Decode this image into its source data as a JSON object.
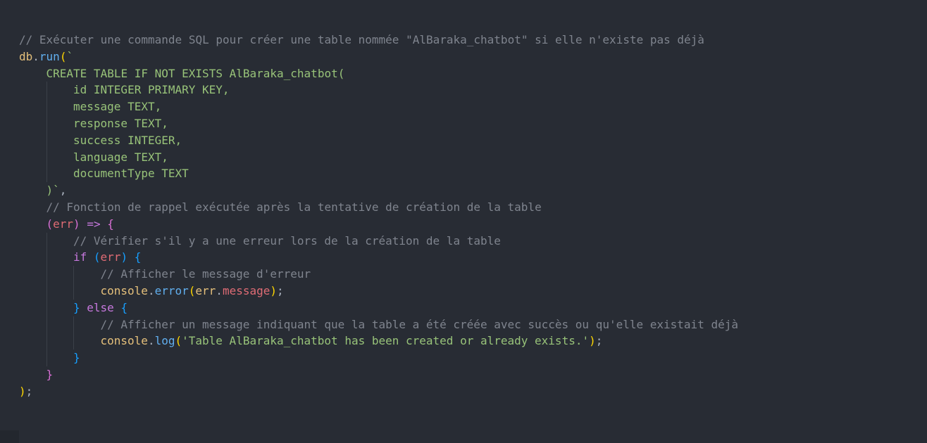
{
  "colors": {
    "background": "#282c34",
    "comment": "#7f848e",
    "string": "#98c379",
    "function": "#61afef",
    "object": "#e5c07b",
    "parameter": "#e06c75",
    "keyword": "#c678dd",
    "bracket_gold": "#ffd700",
    "bracket_magenta": "#da70d6",
    "bracket_blue": "#179fff"
  },
  "lines": [
    {
      "indent": 0,
      "tokens": [
        {
          "text": "// Exécuter une commande SQL pour créer une table nommée \"AlBaraka_chatbot\" si elle n'existe pas déjà",
          "type": "comment"
        }
      ]
    },
    {
      "indent": 0,
      "tokens": [
        {
          "text": "db",
          "type": "obj"
        },
        {
          "text": ".",
          "type": "plain"
        },
        {
          "text": "run",
          "type": "func"
        },
        {
          "text": "(",
          "type": "brace-y"
        },
        {
          "text": "`",
          "type": "string"
        }
      ]
    },
    {
      "indent": 1,
      "tokens": [
        {
          "text": "CREATE TABLE IF NOT EXISTS AlBaraka_chatbot(",
          "type": "string"
        }
      ]
    },
    {
      "indent": 2,
      "tokens": [
        {
          "text": "id INTEGER PRIMARY KEY,",
          "type": "string"
        }
      ]
    },
    {
      "indent": 2,
      "tokens": [
        {
          "text": "message TEXT,",
          "type": "string"
        }
      ]
    },
    {
      "indent": 2,
      "tokens": [
        {
          "text": "response TEXT,",
          "type": "string"
        }
      ]
    },
    {
      "indent": 2,
      "tokens": [
        {
          "text": "success INTEGER,",
          "type": "string"
        }
      ]
    },
    {
      "indent": 2,
      "tokens": [
        {
          "text": "language TEXT,",
          "type": "string"
        }
      ]
    },
    {
      "indent": 2,
      "tokens": [
        {
          "text": "documentType TEXT",
          "type": "string"
        }
      ]
    },
    {
      "indent": 1,
      "tokens": [
        {
          "text": ")`",
          "type": "string"
        },
        {
          "text": ",",
          "type": "plain"
        }
      ]
    },
    {
      "indent": 1,
      "tokens": [
        {
          "text": "// Fonction de rappel exécutée après la tentative de création de la table",
          "type": "comment"
        }
      ]
    },
    {
      "indent": 1,
      "tokens": [
        {
          "text": "(",
          "type": "brace1"
        },
        {
          "text": "err",
          "type": "param"
        },
        {
          "text": ")",
          "type": "brace1"
        },
        {
          "text": " ",
          "type": "plain"
        },
        {
          "text": "=>",
          "type": "keyword"
        },
        {
          "text": " ",
          "type": "plain"
        },
        {
          "text": "{",
          "type": "brace1"
        }
      ]
    },
    {
      "indent": 2,
      "tokens": [
        {
          "text": "// Vérifier s'il y a une erreur lors de la création de la table",
          "type": "comment"
        }
      ]
    },
    {
      "indent": 2,
      "tokens": [
        {
          "text": "if",
          "type": "keyword"
        },
        {
          "text": " ",
          "type": "plain"
        },
        {
          "text": "(",
          "type": "brace2"
        },
        {
          "text": "err",
          "type": "param"
        },
        {
          "text": ")",
          "type": "brace2"
        },
        {
          "text": " ",
          "type": "plain"
        },
        {
          "text": "{",
          "type": "brace2"
        }
      ]
    },
    {
      "indent": 3,
      "tokens": [
        {
          "text": "// Afficher le message d'erreur",
          "type": "comment"
        }
      ]
    },
    {
      "indent": 3,
      "tokens": [
        {
          "text": "console",
          "type": "obj"
        },
        {
          "text": ".",
          "type": "plain"
        },
        {
          "text": "error",
          "type": "func"
        },
        {
          "text": "(",
          "type": "brace-y"
        },
        {
          "text": "err",
          "type": "obj"
        },
        {
          "text": ".",
          "type": "plain"
        },
        {
          "text": "message",
          "type": "param"
        },
        {
          "text": ")",
          "type": "brace-y"
        },
        {
          "text": ";",
          "type": "plain"
        }
      ]
    },
    {
      "indent": 2,
      "tokens": [
        {
          "text": "}",
          "type": "brace2"
        },
        {
          "text": " ",
          "type": "plain"
        },
        {
          "text": "else",
          "type": "keyword"
        },
        {
          "text": " ",
          "type": "plain"
        },
        {
          "text": "{",
          "type": "brace2"
        }
      ]
    },
    {
      "indent": 3,
      "tokens": [
        {
          "text": "// Afficher un message indiquant que la table a été créée avec succès ou qu'elle existait déjà",
          "type": "comment"
        }
      ]
    },
    {
      "indent": 3,
      "tokens": [
        {
          "text": "console",
          "type": "obj"
        },
        {
          "text": ".",
          "type": "plain"
        },
        {
          "text": "log",
          "type": "func"
        },
        {
          "text": "(",
          "type": "brace-y"
        },
        {
          "text": "'Table AlBaraka_chatbot has been created or already exists.'",
          "type": "string"
        },
        {
          "text": ")",
          "type": "brace-y"
        },
        {
          "text": ";",
          "type": "plain"
        }
      ]
    },
    {
      "indent": 2,
      "tokens": [
        {
          "text": "}",
          "type": "brace2"
        }
      ]
    },
    {
      "indent": 1,
      "tokens": [
        {
          "text": "}",
          "type": "brace1"
        }
      ]
    },
    {
      "indent": 0,
      "tokens": [
        {
          "text": ")",
          "type": "brace-y"
        },
        {
          "text": ";",
          "type": "plain"
        }
      ]
    }
  ]
}
